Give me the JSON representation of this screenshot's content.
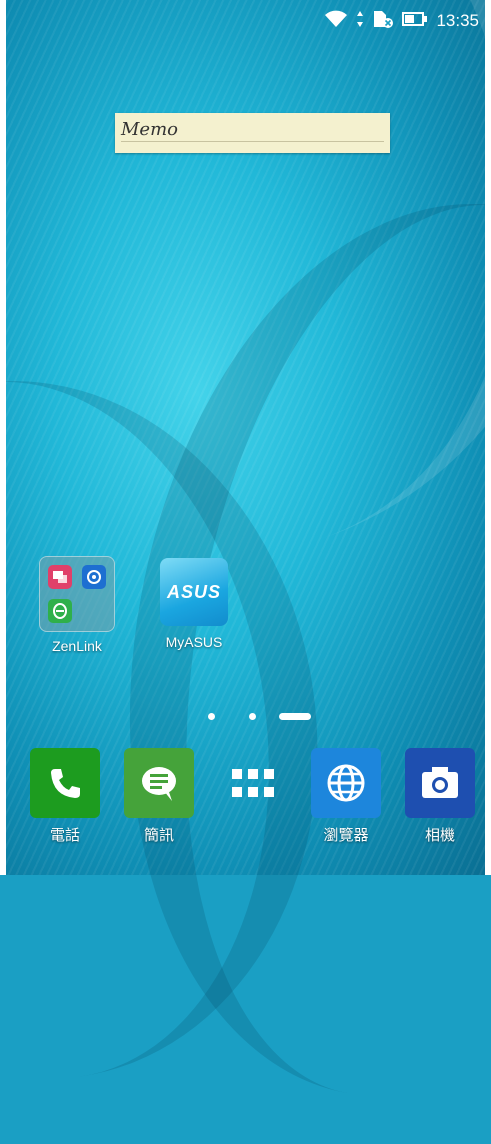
{
  "status_bar": {
    "time": "13:35",
    "icons": [
      "wifi-icon",
      "data-activity-icon",
      "sim-card-off-icon",
      "battery-icon"
    ]
  },
  "memo_widget": {
    "text": "Memo"
  },
  "home_apps": [
    {
      "label": "ZenLink",
      "type": "folder"
    },
    {
      "label": "MyASUS",
      "icon_text": "ASUS"
    }
  ],
  "page_indicator": {
    "pages": 3,
    "current": 3
  },
  "dock": [
    {
      "label": "電話",
      "icon": "phone-icon",
      "color": "#1d9c1f"
    },
    {
      "label": "簡訊",
      "icon": "message-icon",
      "color": "#45a33a"
    },
    {
      "label": "",
      "icon": "app-drawer-icon"
    },
    {
      "label": "瀏覽器",
      "icon": "browser-icon",
      "color": "#1d86dc"
    },
    {
      "label": "相機",
      "icon": "camera-icon",
      "color": "#1e4fb0"
    }
  ]
}
